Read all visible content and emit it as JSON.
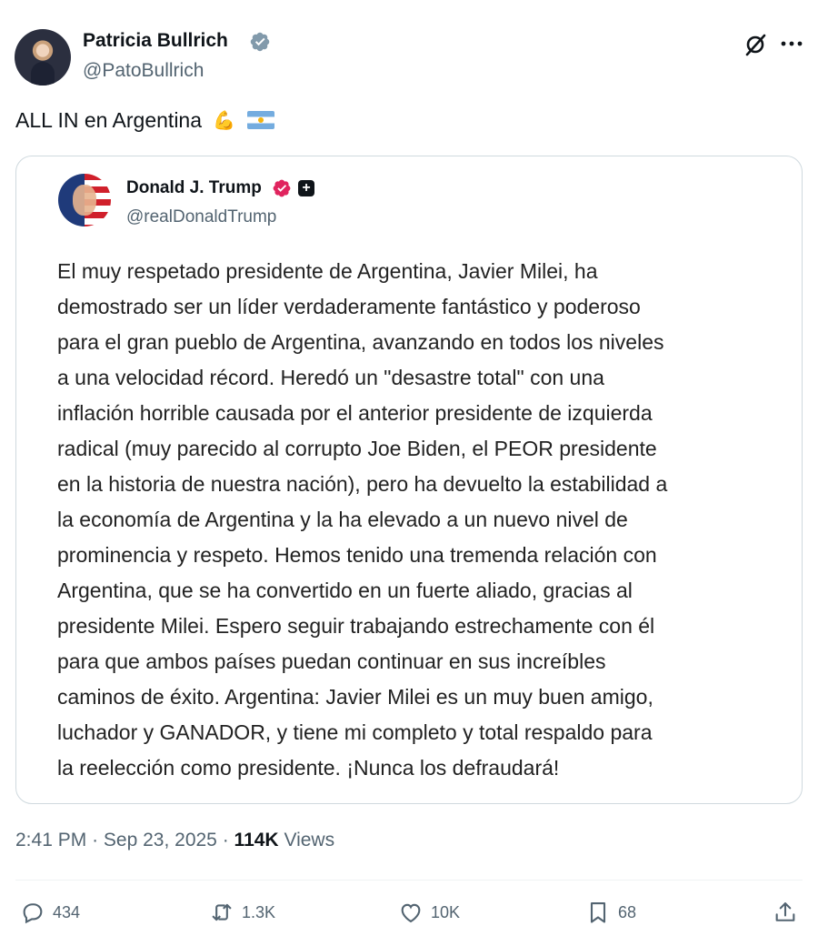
{
  "author": {
    "name": "Patricia Bullrich",
    "handle": "@PatoBullrich",
    "avatar_icon": "user-avatar"
  },
  "header_icons": [
    "grok-icon",
    "more-icon"
  ],
  "tweet": {
    "text": "ALL IN en Argentina",
    "emojis": [
      "flexed-biceps-emoji",
      "argentina-flag-emoji"
    ]
  },
  "quoted": {
    "name": "Donald J. Trump",
    "handle": "@realDonaldTrump",
    "body": "El muy respetado presidente de Argentina, Javier Milei, ha\ndemostrado ser un líder verdaderamente fantástico y poderoso\npara el gran pueblo de Argentina, avanzando en todos los niveles\na una velocidad récord. Heredó un \"desastre total\" con una\ninflación horrible causada por el anterior presidente de izquierda\nradical (muy parecido al corrupto Joe Biden, el PEOR presidente\nen la historia de nuestra nación), pero ha devuelto la estabilidad a\nla economía de Argentina y la ha elevado a un nuevo nivel de\nprominencia y respeto. Hemos tenido una tremenda relación con\nArgentina, que se ha convertido en un fuerte aliado, gracias al\npresidente Milei. Espero seguir trabajando estrechamente con él\npara que ambos países puedan continuar en sus increíbles\ncaminos de éxito. Argentina: Javier Milei es un muy buen amigo,\nluchador y GANADOR, y tiene mi completo y total respaldo para\nla reelección como presidente. ¡Nunca los defraudará!"
  },
  "meta": {
    "time": "2:41 PM",
    "sep": "·",
    "date": "Sep 23, 2025",
    "sep2": "·",
    "views_count": "114K",
    "views_label": "Views"
  },
  "actions": {
    "replies": "434",
    "reposts": "1.3K",
    "likes": "10K",
    "bookmarks": "68"
  },
  "colors": {
    "verified_blue": "#829aab",
    "verified_pink": "#e0245e",
    "secondary_text": "#536471",
    "border": "#cfd9de"
  }
}
